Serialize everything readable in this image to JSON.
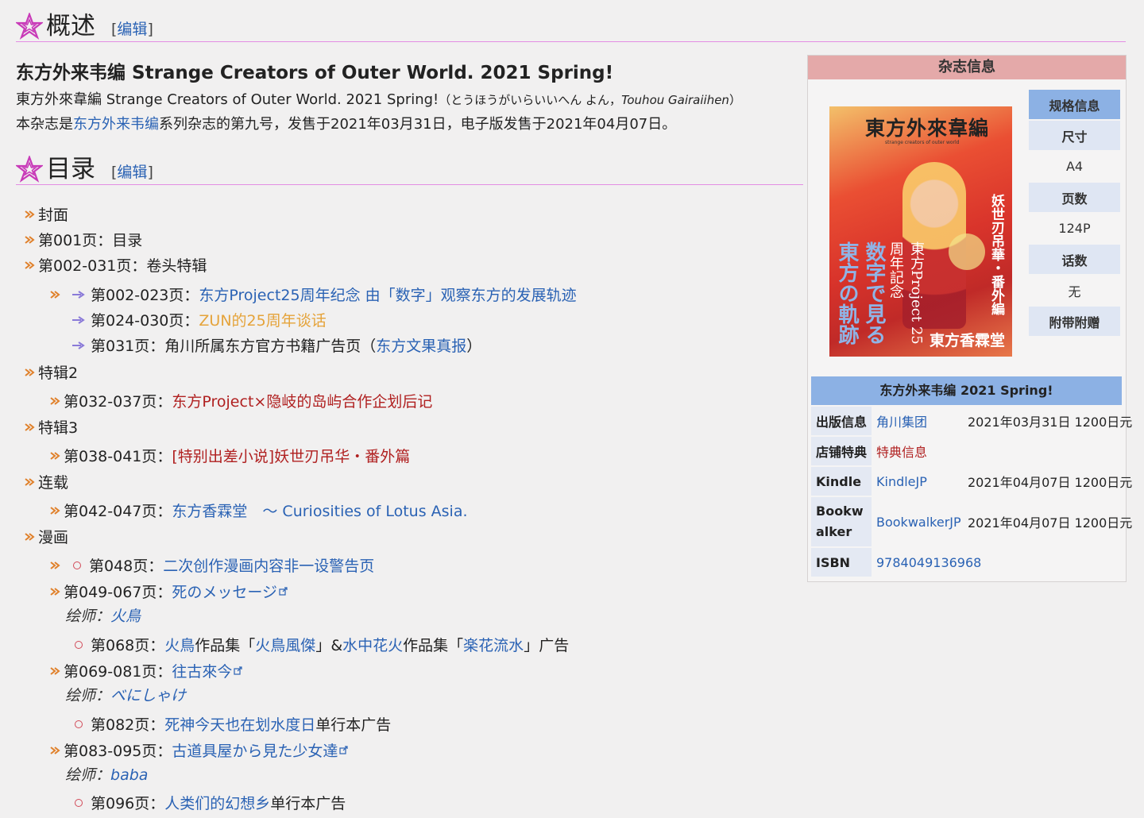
{
  "headings": {
    "overview": {
      "title": "概述",
      "edit_label": "编辑"
    },
    "toc": {
      "title": "目录",
      "edit_label": "编辑"
    }
  },
  "intro": {
    "bold_title": "东方外来韦编 Strange Creators of Outer World. 2021 Spring!",
    "line1_main": "東方外來韋編 Strange Creators of Outer World. 2021 Spring!",
    "line1_reading": "（とうほうがいらいいへん よん，",
    "line1_romaji": "Touhou Gairaiihen",
    "line1_close": "）",
    "line2_a": "本杂志是",
    "line2_link": "东方外来韦编",
    "line2_b": "系列杂志的第九号，发售于2021年03月31日，电子版发售于2021年04月07日。"
  },
  "toc": {
    "cover": "封面",
    "p001": "第001页：目录",
    "p002": "第002-031页：卷头特辑",
    "p002_023": {
      "prefix": "第002-023页：",
      "link": "东方Project25周年纪念 由「数字」观察东方的发展轨迹"
    },
    "p024_030": {
      "prefix": "第024-030页：",
      "link": "ZUN的25周年谈话"
    },
    "p031": {
      "prefix": "第031页：角川所属东方官方书籍广告页（",
      "link": "东方文果真报",
      "suffix": "）"
    },
    "special2": "特辑2",
    "p032_037": {
      "prefix": "第032-037页：",
      "link": "东方Project×隐岐的岛屿合作企划后记"
    },
    "special3": "特辑3",
    "p038_041": {
      "prefix": "第038-041页：",
      "link": "[特别出差小说]妖世刃吊华・番外篇"
    },
    "serial": "连载",
    "p042_047": {
      "prefix": "第042-047页：",
      "link": "东方香霖堂　～ Curiosities of Lotus Asia."
    },
    "manga": "漫画",
    "p048": {
      "prefix": "第048页：",
      "link": "二次创作漫画内容非一设警告页"
    },
    "p049_067": {
      "prefix": "第049-067页：",
      "link": "死のメッセージ",
      "painter_label": "绘师：",
      "painter": "火鳥"
    },
    "p068": {
      "prefix": "第068页：",
      "link1": "火鳥",
      "mid1": "作品集「",
      "link2": "火鳥風傑",
      "mid2": "」&",
      "link3": "水中花火",
      "mid3": "作品集「",
      "link4": "楽花流水",
      "suffix": "」广告"
    },
    "p069_081": {
      "prefix": "第069-081页：",
      "link": "往古來今",
      "painter_label": "绘师：",
      "painter": "べにしゃけ"
    },
    "p082": {
      "prefix": "第082页：",
      "link": "死神今天也在划水度日",
      "suffix": "单行本广告"
    },
    "p083_095": {
      "prefix": "第083-095页：",
      "link": "古道具屋から見た少女達",
      "painter_label": "绘师：",
      "painter": "baba"
    },
    "p096": {
      "prefix": "第096页：",
      "link": "人类们的幻想乡",
      "suffix": "单行本广告"
    }
  },
  "infobox": {
    "title": "杂志信息",
    "cover": {
      "title": "東方外來韋編",
      "subtitle": "strange creators of outer world",
      "vertical1": "東方の軌跡",
      "vertical2": "数字で見る",
      "vertical3": "東方Project 25周年記念",
      "vertical4": "妖世刃吊華・番外編",
      "publisher": "東方香霖堂"
    },
    "specs": {
      "header": "规格信息",
      "size_label": "尺寸",
      "size": "A4",
      "pages_label": "页数",
      "pages": "124P",
      "topic_label": "话数",
      "topic": "无",
      "extras_label": "附带附赠"
    },
    "pub_header": "东方外来韦编 2021 Spring!",
    "rows": [
      {
        "k": "出版信息",
        "v": "角川集团",
        "d": "2021年03月31日  1200日元"
      },
      {
        "k": "店铺特典",
        "v": "特典信息",
        "d": ""
      },
      {
        "k": "Kindle",
        "v": "KindleJP",
        "d": "2021年04月07日  1200日元"
      },
      {
        "k": "Bookwalker",
        "v": "BookwalkerJP",
        "d": "2021年04月07日  1200日元"
      },
      {
        "k": "ISBN",
        "v": "9784049136968",
        "d": ""
      }
    ]
  }
}
